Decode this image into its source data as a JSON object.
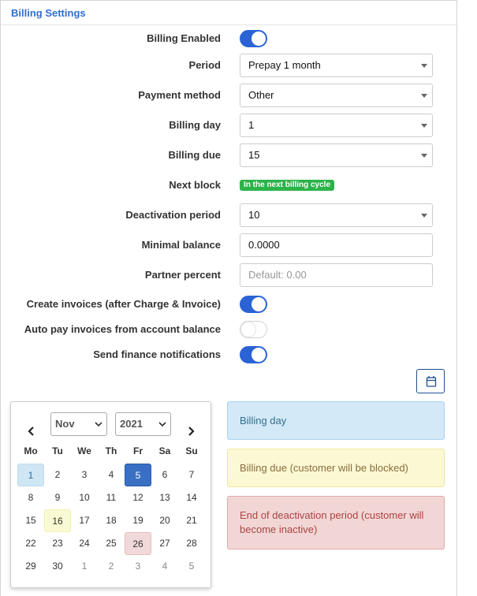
{
  "section_title": "Billing Settings",
  "fields": {
    "billing_enabled": {
      "label": "Billing Enabled",
      "on": true
    },
    "period": {
      "label": "Period",
      "value": "Prepay 1 month"
    },
    "payment_method": {
      "label": "Payment method",
      "value": "Other"
    },
    "billing_day": {
      "label": "Billing day",
      "value": "1"
    },
    "billing_due": {
      "label": "Billing due",
      "value": "15"
    },
    "next_block": {
      "label": "Next block",
      "badge": "In the next billing cycle"
    },
    "deactivation_period": {
      "label": "Deactivation period",
      "value": "10"
    },
    "minimal_balance": {
      "label": "Minimal balance",
      "value": "0.0000"
    },
    "partner_percent": {
      "label": "Partner percent",
      "placeholder": "Default: 0.00"
    },
    "create_invoices": {
      "label": "Create invoices (after Charge & Invoice)",
      "on": true
    },
    "auto_pay": {
      "label": "Auto pay invoices from account balance",
      "on": false
    },
    "send_notifications": {
      "label": "Send finance notifications",
      "on": true
    }
  },
  "calendar": {
    "month": "Nov",
    "year": "2021",
    "weekdays": [
      "Mo",
      "Tu",
      "We",
      "Th",
      "Fr",
      "Sa",
      "Su"
    ],
    "weeks": [
      [
        "1",
        "2",
        "3",
        "4",
        "5",
        "6",
        "7"
      ],
      [
        "8",
        "9",
        "10",
        "11",
        "12",
        "13",
        "14"
      ],
      [
        "15",
        "16",
        "17",
        "18",
        "19",
        "20",
        "21"
      ],
      [
        "22",
        "23",
        "24",
        "25",
        "26",
        "27",
        "28"
      ],
      [
        "29",
        "30",
        "1",
        "2",
        "3",
        "4",
        "5"
      ]
    ]
  },
  "legend": {
    "billing_day": "Billing day",
    "billing_due": "Billing due (customer will be blocked)",
    "deactivation": "End of deactivation period (customer will become inactive)"
  },
  "colors": {
    "accent": "#2b63d6",
    "badge_green": "#2cb34a",
    "billing_day_bg": "#cfe6f4",
    "billing_due_bg": "#fafad2",
    "deactivation_bg": "#f2d9d9",
    "selected_day_bg": "#3a70c4"
  },
  "icons": {
    "calendar_button": "calendar-icon",
    "prev": "chevron-left-icon",
    "next": "chevron-right-icon"
  }
}
